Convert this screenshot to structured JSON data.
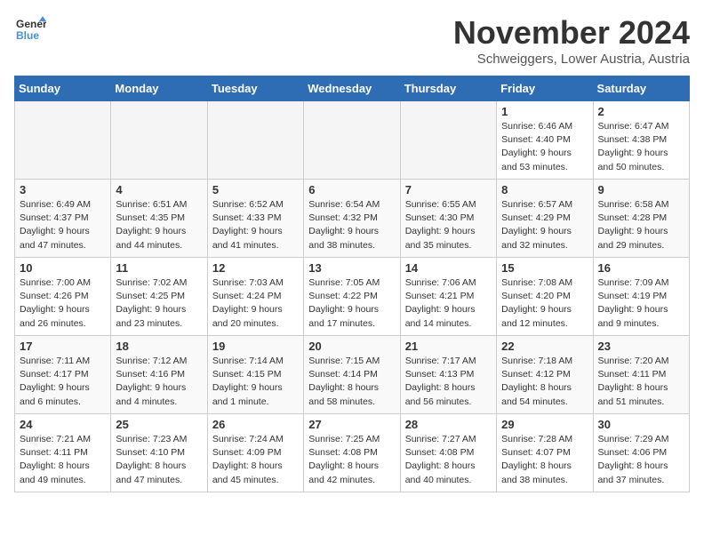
{
  "header": {
    "logo_line1": "General",
    "logo_line2": "Blue",
    "month_title": "November 2024",
    "location": "Schweiggers, Lower Austria, Austria"
  },
  "days_of_week": [
    "Sunday",
    "Monday",
    "Tuesday",
    "Wednesday",
    "Thursday",
    "Friday",
    "Saturday"
  ],
  "weeks": [
    [
      {
        "day": "",
        "empty": true
      },
      {
        "day": "",
        "empty": true
      },
      {
        "day": "",
        "empty": true
      },
      {
        "day": "",
        "empty": true
      },
      {
        "day": "",
        "empty": true
      },
      {
        "day": "1",
        "sunrise": "6:46 AM",
        "sunset": "4:40 PM",
        "daylight": "9 hours and 53 minutes."
      },
      {
        "day": "2",
        "sunrise": "6:47 AM",
        "sunset": "4:38 PM",
        "daylight": "9 hours and 50 minutes."
      }
    ],
    [
      {
        "day": "3",
        "sunrise": "6:49 AM",
        "sunset": "4:37 PM",
        "daylight": "9 hours and 47 minutes."
      },
      {
        "day": "4",
        "sunrise": "6:51 AM",
        "sunset": "4:35 PM",
        "daylight": "9 hours and 44 minutes."
      },
      {
        "day": "5",
        "sunrise": "6:52 AM",
        "sunset": "4:33 PM",
        "daylight": "9 hours and 41 minutes."
      },
      {
        "day": "6",
        "sunrise": "6:54 AM",
        "sunset": "4:32 PM",
        "daylight": "9 hours and 38 minutes."
      },
      {
        "day": "7",
        "sunrise": "6:55 AM",
        "sunset": "4:30 PM",
        "daylight": "9 hours and 35 minutes."
      },
      {
        "day": "8",
        "sunrise": "6:57 AM",
        "sunset": "4:29 PM",
        "daylight": "9 hours and 32 minutes."
      },
      {
        "day": "9",
        "sunrise": "6:58 AM",
        "sunset": "4:28 PM",
        "daylight": "9 hours and 29 minutes."
      }
    ],
    [
      {
        "day": "10",
        "sunrise": "7:00 AM",
        "sunset": "4:26 PM",
        "daylight": "9 hours and 26 minutes."
      },
      {
        "day": "11",
        "sunrise": "7:02 AM",
        "sunset": "4:25 PM",
        "daylight": "9 hours and 23 minutes."
      },
      {
        "day": "12",
        "sunrise": "7:03 AM",
        "sunset": "4:24 PM",
        "daylight": "9 hours and 20 minutes."
      },
      {
        "day": "13",
        "sunrise": "7:05 AM",
        "sunset": "4:22 PM",
        "daylight": "9 hours and 17 minutes."
      },
      {
        "day": "14",
        "sunrise": "7:06 AM",
        "sunset": "4:21 PM",
        "daylight": "9 hours and 14 minutes."
      },
      {
        "day": "15",
        "sunrise": "7:08 AM",
        "sunset": "4:20 PM",
        "daylight": "9 hours and 12 minutes."
      },
      {
        "day": "16",
        "sunrise": "7:09 AM",
        "sunset": "4:19 PM",
        "daylight": "9 hours and 9 minutes."
      }
    ],
    [
      {
        "day": "17",
        "sunrise": "7:11 AM",
        "sunset": "4:17 PM",
        "daylight": "9 hours and 6 minutes."
      },
      {
        "day": "18",
        "sunrise": "7:12 AM",
        "sunset": "4:16 PM",
        "daylight": "9 hours and 4 minutes."
      },
      {
        "day": "19",
        "sunrise": "7:14 AM",
        "sunset": "4:15 PM",
        "daylight": "9 hours and 1 minute."
      },
      {
        "day": "20",
        "sunrise": "7:15 AM",
        "sunset": "4:14 PM",
        "daylight": "8 hours and 58 minutes."
      },
      {
        "day": "21",
        "sunrise": "7:17 AM",
        "sunset": "4:13 PM",
        "daylight": "8 hours and 56 minutes."
      },
      {
        "day": "22",
        "sunrise": "7:18 AM",
        "sunset": "4:12 PM",
        "daylight": "8 hours and 54 minutes."
      },
      {
        "day": "23",
        "sunrise": "7:20 AM",
        "sunset": "4:11 PM",
        "daylight": "8 hours and 51 minutes."
      }
    ],
    [
      {
        "day": "24",
        "sunrise": "7:21 AM",
        "sunset": "4:11 PM",
        "daylight": "8 hours and 49 minutes."
      },
      {
        "day": "25",
        "sunrise": "7:23 AM",
        "sunset": "4:10 PM",
        "daylight": "8 hours and 47 minutes."
      },
      {
        "day": "26",
        "sunrise": "7:24 AM",
        "sunset": "4:09 PM",
        "daylight": "8 hours and 45 minutes."
      },
      {
        "day": "27",
        "sunrise": "7:25 AM",
        "sunset": "4:08 PM",
        "daylight": "8 hours and 42 minutes."
      },
      {
        "day": "28",
        "sunrise": "7:27 AM",
        "sunset": "4:08 PM",
        "daylight": "8 hours and 40 minutes."
      },
      {
        "day": "29",
        "sunrise": "7:28 AM",
        "sunset": "4:07 PM",
        "daylight": "8 hours and 38 minutes."
      },
      {
        "day": "30",
        "sunrise": "7:29 AM",
        "sunset": "4:06 PM",
        "daylight": "8 hours and 37 minutes."
      }
    ]
  ]
}
